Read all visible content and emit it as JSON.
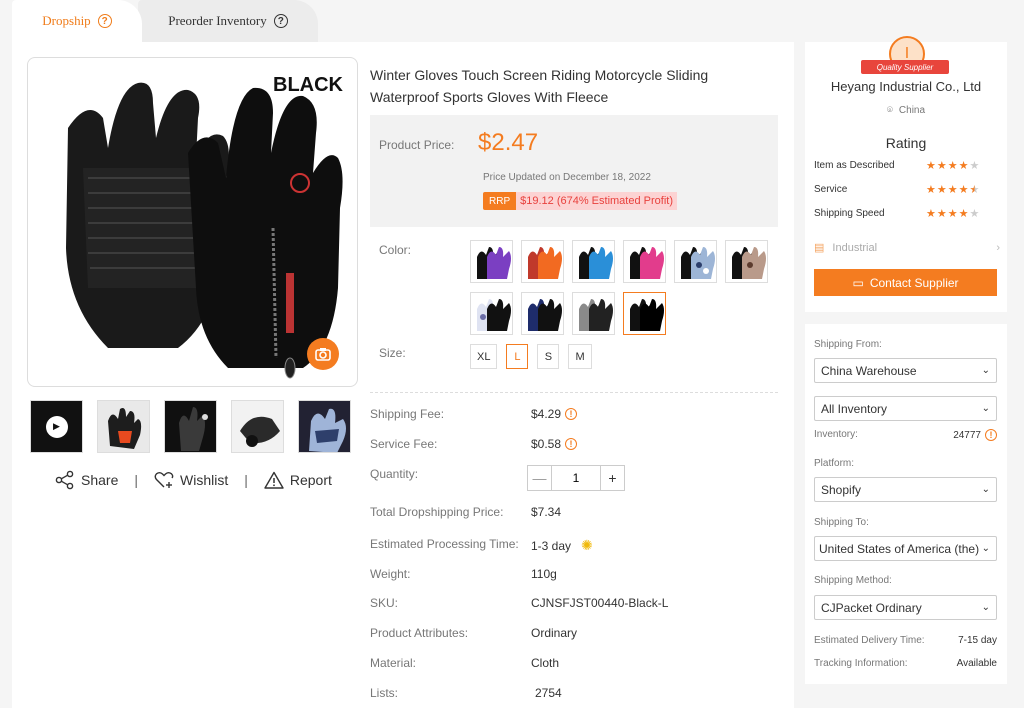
{
  "tabs": {
    "dropship": "Dropship",
    "preorder": "Preorder Inventory"
  },
  "gallery": {
    "image_label": "BLACK"
  },
  "actions": {
    "share": "Share",
    "wishlist": "Wishlist",
    "report": "Report",
    "separator": "|"
  },
  "product": {
    "title": "Winter Gloves Touch Screen Riding Motorcycle Sliding Waterproof Sports Gloves With Fleece",
    "price_label": "Product Price:",
    "price": "$2.47",
    "updated": "Price Updated on December 18, 2022",
    "rrp_tag": "RRP",
    "rrp_value": "$19.12 (674% Estimated Profit)",
    "color_label": "Color:",
    "size_label": "Size:",
    "colors": [
      "purple",
      "orange",
      "blue",
      "pink",
      "camo-blue",
      "camo-brown",
      "camo-white",
      "navy",
      "gray",
      "black"
    ],
    "selected_color": "black",
    "sizes": [
      "XL",
      "L",
      "S",
      "M"
    ],
    "selected_size": "L"
  },
  "details": {
    "shipping_fee_label": "Shipping Fee:",
    "shipping_fee": "$4.29",
    "service_fee_label": "Service Fee:",
    "service_fee": "$0.58",
    "quantity_label": "Quantity:",
    "quantity": "1",
    "total_label": "Total Dropshipping Price:",
    "total": "$7.34",
    "processing_label": "Estimated Processing Time:",
    "processing": "1-3 day",
    "weight_label": "Weight:",
    "weight": "110g",
    "sku_label": "SKU:",
    "sku": "CJNSFJST00440-Black-L",
    "attributes_label": "Product Attributes:",
    "attributes": "Ordinary",
    "material_label": "Material:",
    "material": "Cloth",
    "lists_label": "Lists:",
    "lists": "2754"
  },
  "supplier": {
    "badge_initial": "I",
    "badge_text": "Quality Supplier",
    "name": "Heyang Industrial Co., Ltd",
    "location": "China",
    "rating_title": "Rating",
    "ratings": [
      {
        "label": "Item as Described",
        "stars": 4
      },
      {
        "label": "Service",
        "stars": 4.5
      },
      {
        "label": "Shipping Speed",
        "stars": 4
      }
    ],
    "category": "Industrial",
    "contact_button": "Contact Supplier"
  },
  "shipping": {
    "from_label": "Shipping From:",
    "from_value": "China Warehouse",
    "inventory_filter": "All Inventory",
    "inventory_label": "Inventory:",
    "inventory_value": "24777",
    "platform_label": "Platform:",
    "platform_value": "Shopify",
    "to_label": "Shipping To:",
    "to_value": "United States of America (the)",
    "method_label": "Shipping Method:",
    "method_value": "CJPacket Ordinary",
    "delivery_label": "Estimated Delivery Time:",
    "delivery_value": "7-15 day",
    "tracking_label": "Tracking Information:",
    "tracking_value": "Available"
  },
  "colors": {
    "accent": "#f47c20",
    "rrp_text": "#e8413d",
    "rrp_bg": "#fcd3d3",
    "badge_red": "#e8453c"
  }
}
